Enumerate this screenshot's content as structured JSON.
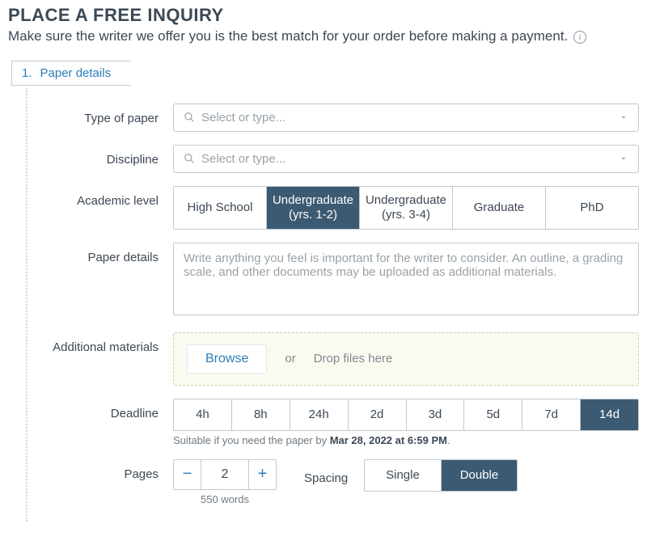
{
  "header": {
    "title": "PLACE A FREE INQUIRY",
    "subtitle": "Make sure the writer we offer you is the best match for your order before making a payment."
  },
  "step": {
    "number": "1.",
    "label": "Paper details"
  },
  "fields": {
    "type_of_paper": {
      "label": "Type of paper",
      "placeholder": "Select or type..."
    },
    "discipline": {
      "label": "Discipline",
      "placeholder": "Select or type..."
    },
    "academic_level": {
      "label": "Academic level",
      "options": [
        "High School",
        "Undergraduate (yrs. 1-2)",
        "Undergraduate (yrs. 3-4)",
        "Graduate",
        "PhD"
      ],
      "selected_index": 1
    },
    "paper_details": {
      "label": "Paper details",
      "placeholder": "Write anything you feel is important for the writer to consider. An outline, a grading scale, and other documents may be uploaded as additional materials."
    },
    "additional_materials": {
      "label": "Additional materials",
      "browse": "Browse",
      "or": "or",
      "drop": "Drop files here"
    },
    "deadline": {
      "label": "Deadline",
      "options": [
        "4h",
        "8h",
        "24h",
        "2d",
        "3d",
        "5d",
        "7d",
        "14d"
      ],
      "selected_index": 7,
      "hint_prefix": "Suitable if you need the paper by ",
      "hint_bold": "Mar 28, 2022 at 6:59 PM",
      "hint_suffix": "."
    },
    "pages": {
      "label": "Pages",
      "value": "2",
      "words": "550 words"
    },
    "spacing": {
      "label": "Spacing",
      "options": [
        "Single",
        "Double"
      ],
      "selected_index": 1
    }
  }
}
